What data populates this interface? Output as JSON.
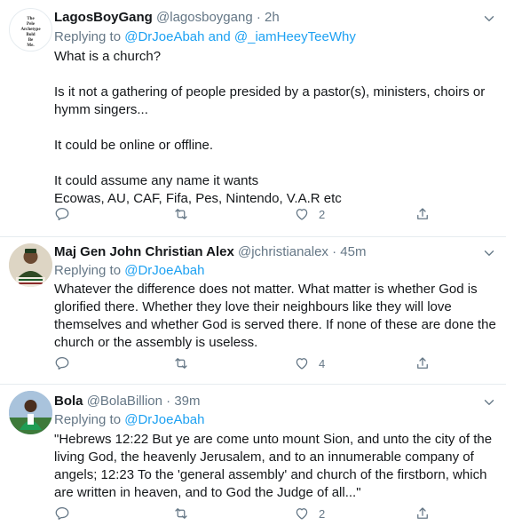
{
  "tweets": [
    {
      "name": "LagosBoyGang",
      "handle": "@lagosboygang",
      "time": "2h",
      "replying_prefix": "Replying to",
      "reply_to_1": "@DrJoeAbah",
      "reply_joiner": "and",
      "reply_to_2": "@_iamHeeyTeeWhy",
      "body": "What is a church?\n\nIs it not a gathering of people presided by a pastor(s), ministers, choirs or hymm singers...\n\nIt could be online or offline.\n\nIt could assume any name it wants\nEcowas, AU, CAF, Fifa, Pes, Nintendo, V.A.R etc",
      "replies": "",
      "retweets": "",
      "likes": "2",
      "avatar_text": [
        "The",
        "Pele",
        "Archetype",
        "Bold",
        "Be",
        "Me."
      ]
    },
    {
      "name": "Maj Gen John Christian Alex",
      "handle": "@jchristianalex",
      "time": "45m",
      "replying_prefix": "Replying to",
      "reply_to_1": "@DrJoeAbah",
      "body": "Whatever the difference does not matter. What matter is whether God is glorified there. Whether they love their neighbours like they will love themselves and whether God is served there. If none of these are done the church or the assembly is useless.",
      "replies": "",
      "retweets": "",
      "likes": "4"
    },
    {
      "name": "Bola",
      "handle": "@BolaBillion",
      "time": "39m",
      "replying_prefix": "Replying to",
      "reply_to_1": "@DrJoeAbah",
      "body": "\"Hebrews  12:22 But ye are come unto mount Sion, and unto the city of the living God, the heavenly Jerusalem, and to an innumerable company of angels;  12:23 To the 'general assembly' and church of the firstborn, which are written in heaven, and to God the Judge of all...\"",
      "replies": "",
      "retweets": "",
      "likes": "2"
    }
  ],
  "colors": {
    "link": "#1da1f2",
    "muted": "#657786",
    "text": "#14171a",
    "divider": "#e6ecf0"
  },
  "icons": [
    "reply-icon",
    "retweet-icon",
    "like-icon",
    "share-icon",
    "chevron-down-icon"
  ]
}
